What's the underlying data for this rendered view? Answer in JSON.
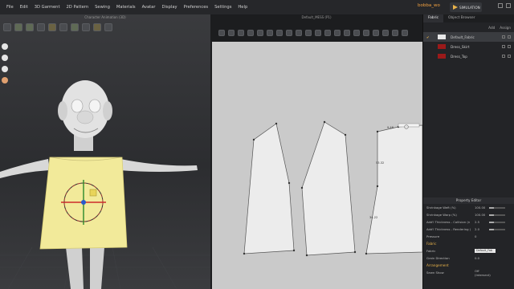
{
  "menu": {
    "items": [
      "File",
      "Edit",
      "3D Garment",
      "2D Pattern",
      "Sewing",
      "Materials",
      "Avatar",
      "Display",
      "Preferences",
      "Settings",
      "Help"
    ],
    "project_name": "bobba_wo",
    "simulation_label": "SIMULATION"
  },
  "view3d": {
    "title": "Character Animation (3D)"
  },
  "view2d": {
    "title": "Default_MESS (P1)",
    "measure_1": "53.32",
    "measure_2": "34.22",
    "measure_3": "9.48"
  },
  "right_panel": {
    "tabs": [
      "Fabric",
      "Object Browser"
    ],
    "add_label": "Add",
    "assign_label": "Assign",
    "fabrics": [
      {
        "name": "Default_Fabric",
        "color": "#e8e8e8",
        "selected": true
      },
      {
        "name": "Dress_Skirt",
        "color": "#9a1a1a",
        "selected": false
      },
      {
        "name": "Dress_Top",
        "color": "#9a1a1a",
        "selected": false
      }
    ],
    "property_editor": {
      "title": "Property Editor",
      "properties": [
        {
          "label": "Shrinkage Weft (%)",
          "value": "100.00"
        },
        {
          "label": "Shrinkage Warp (%)",
          "value": "100.00"
        },
        {
          "label": "Add'l Thickness - Collision (n",
          "value": "2.5"
        },
        {
          "label": "Add'l Thickness - Rendering (",
          "value": "2.0"
        },
        {
          "label": "Pressure",
          "value": "0"
        }
      ],
      "fabric_section": "Fabric",
      "fabric_label": "Fabric",
      "fabric_value": "Default_Fab",
      "grain_label": "Grain Direction",
      "grain_value": "0.0",
      "arrangement_section": "Arrangement",
      "last_label": "Sewn Show",
      "last_value": "Off (Intersect)"
    }
  },
  "colors": {
    "garment_fill": "#f2ea9a",
    "pattern_fill": "#ececec",
    "accent": "#e8b24a"
  }
}
